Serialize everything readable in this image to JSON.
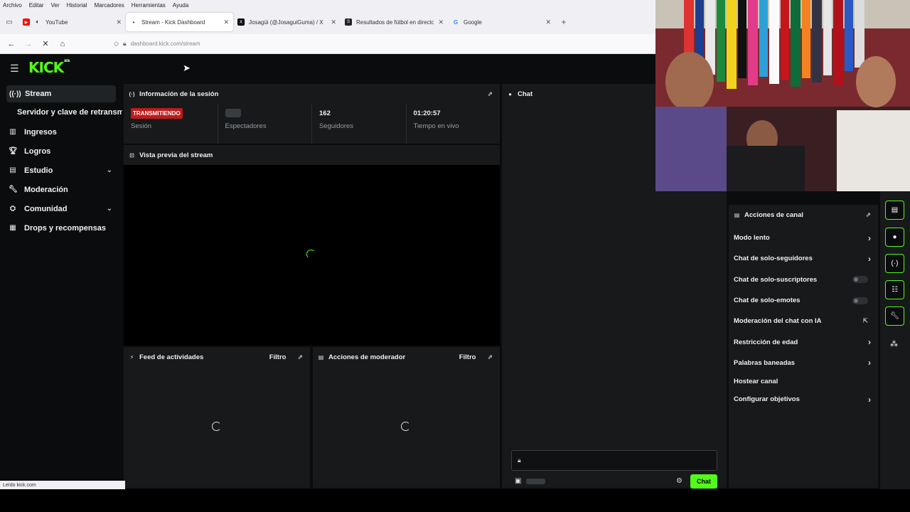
{
  "browser": {
    "menu": [
      "Archivo",
      "Editar",
      "Ver",
      "Historial",
      "Marcadores",
      "Herramientas",
      "Ayuda"
    ],
    "tabs": [
      {
        "title": "YouTube",
        "favicon": "youtube-icon",
        "color": "#ff0000"
      },
      {
        "title": "Stream - Kick Dashboard",
        "favicon": "kick-icon",
        "color": "#53fc18"
      },
      {
        "title": "Josagüi (@JosaguiGuma) / X",
        "favicon": "x-icon",
        "color": "#000000"
      },
      {
        "title": "Resultados de fútbol en directo",
        "favicon": "sofascore-icon",
        "color": "#222222"
      },
      {
        "title": "Google",
        "favicon": "google-icon",
        "color": "#4285f4"
      }
    ],
    "url": "dashboard.kick.com/stream",
    "status_text": "Leído kick.com"
  },
  "app": {
    "logo": "KICK",
    "logo_tag": "BETA",
    "accent": "#53fc18",
    "sidebar": [
      {
        "label": "Stream",
        "icon": "broadcast-icon",
        "active": true
      },
      {
        "label": "Servidor y clave de retransmisión",
        "sub": true
      },
      {
        "label": "Ingresos",
        "icon": "chart-icon"
      },
      {
        "label": "Logros",
        "icon": "trophy-icon"
      },
      {
        "label": "Estudio",
        "icon": "studio-icon",
        "expandable": true
      },
      {
        "label": "Moderación",
        "icon": "wrench-icon"
      },
      {
        "label": "Comunidad",
        "icon": "community-icon",
        "expandable": true
      },
      {
        "label": "Drops y recompensas",
        "icon": "gift-icon"
      }
    ],
    "session": {
      "title": "Información de la sesión",
      "live_badge": "TRANSMITIENDO",
      "session_label": "Sesión",
      "viewers_label": "Espectadores",
      "followers_value": "162",
      "followers_label": "Seguidores",
      "uptime_value": "01:20:57",
      "uptime_label": "Tiempo en vivo"
    },
    "preview": {
      "title": "Vista previa del stream"
    },
    "activity": {
      "title": "Feed de actividades",
      "filter": "Filtro"
    },
    "modactions": {
      "title": "Acciones de moderador",
      "filter": "Filtro"
    },
    "chat": {
      "title": "Chat",
      "send_label": "Chat"
    },
    "channel_actions": {
      "title": "Acciones de canal",
      "items": [
        {
          "label": "Modo lento",
          "control": "arrow"
        },
        {
          "label": "Chat de solo-seguidores",
          "control": "arrow"
        },
        {
          "label": "Chat de solo-suscriptores",
          "control": "toggle",
          "on": false
        },
        {
          "label": "Chat de solo-emotes",
          "control": "toggle",
          "on": false
        },
        {
          "label": "Moderación del chat con IA",
          "control": "external"
        },
        {
          "label": "Restricción de edad",
          "control": "arrow"
        },
        {
          "label": "Palabras baneadas",
          "control": "arrow"
        },
        {
          "label": "Hostear canal",
          "control": "none"
        },
        {
          "label": "Configurar objetivos",
          "control": "arrow"
        }
      ]
    }
  }
}
